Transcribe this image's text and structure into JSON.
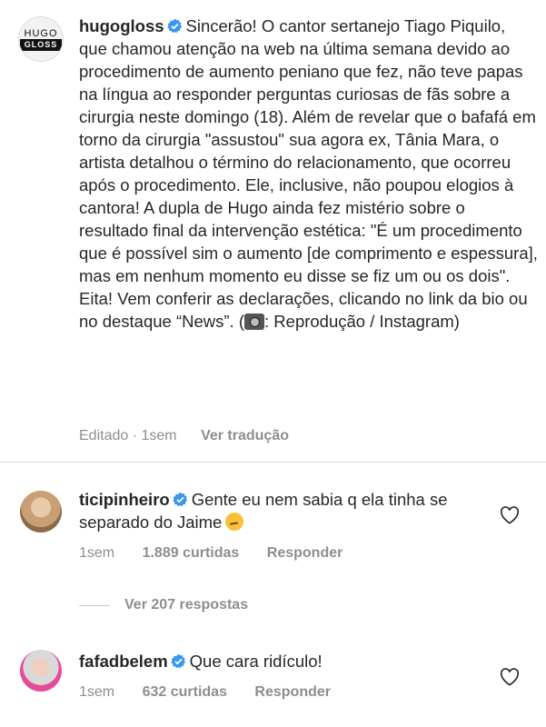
{
  "post": {
    "username": "hugogloss",
    "avatar_text_top": "HUGO",
    "avatar_text_bottom": "GLOSS",
    "caption_part1": "Sincerão! O cantor sertanejo Tiago Piquilo, que chamou atenção na web na última semana devido ao procedimento de aumento peniano que fez, não teve papas na língua ao responder perguntas curiosas de fãs sobre a cirurgia neste domingo (18). Além de revelar que o bafafá em torno da cirurgia \"assustou\" sua agora ex, Tânia Mara, o artista detalhou o término do relacionamento, que ocorreu após o procedimento. Ele, inclusive, não poupou elogios à cantora! A dupla de Hugo ainda fez mistério sobre o resultado final da intervenção estética: \"É um procedimento que é possível sim o aumento [de comprimento e espessura], mas em nenhum momento eu disse se fiz um ou os dois\". Eita! Vem conferir as declarações,  clicando no link da bio ou no destaque “News”. (",
    "caption_part2": ": Reprodução / Instagram)",
    "camera_emoji": "camera-with-flash-emoji",
    "edited_label": "Editado · 1sem",
    "translate_label": "Ver tradução"
  },
  "comments": [
    {
      "username": "ticipinheiro",
      "text": "Gente eu nem sabia q ela tinha se separado do Jaime",
      "emoji": "thinking-face-emoji",
      "time": "1sem",
      "likes": "1.889 curtidas",
      "reply": "Responder",
      "view_replies": "Ver 207 respostas"
    },
    {
      "username": "fafadbelem",
      "text": "Que cara ridículo!",
      "time": "1sem",
      "likes": "632 curtidas",
      "reply": "Responder"
    }
  ],
  "colors": {
    "verified": "#3897f0",
    "text": "#262626",
    "muted": "#8e8e8e"
  }
}
